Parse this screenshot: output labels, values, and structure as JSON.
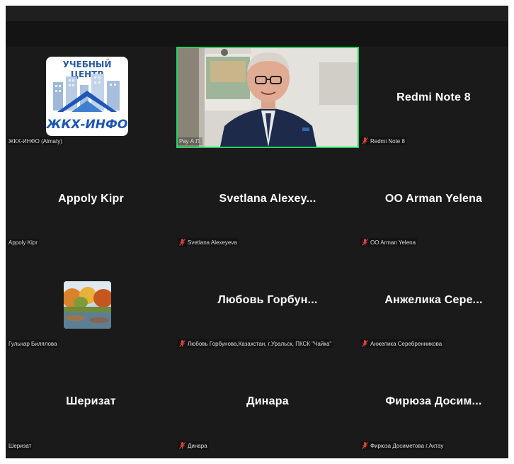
{
  "colors": {
    "background": "#1a1a1a",
    "active_speaker_border": "#23d160",
    "muted_icon": "#e0403a",
    "name_text": "#ffffff"
  },
  "logo": {
    "line1": "УЧЕБНЫЙ ЦЕНТР",
    "line2": "ЖКХ-ИНФО"
  },
  "participants": [
    {
      "display_name": "",
      "label": "ЖКХ-ИНФО (Almaty)",
      "muted": false,
      "video": "logo"
    },
    {
      "display_name": "",
      "label": "Рау А.П.",
      "muted": false,
      "video": "camera",
      "active_speaker": true
    },
    {
      "display_name": "Redmi Note 8",
      "label": "Redmi Note 8",
      "muted": true
    },
    {
      "display_name": "Appoly Kipr",
      "label": "Appoly Kipr",
      "muted": false
    },
    {
      "display_name": "Svetlana  Alexey...",
      "label": "Svetlana Alexeyeva",
      "muted": true
    },
    {
      "display_name": "OO Arman Yelena",
      "label": "OO Arman Yelena",
      "muted": true
    },
    {
      "display_name": "",
      "label": "Гульнар Билялова",
      "muted": false,
      "video": "autumn-photo"
    },
    {
      "display_name": "Любовь  Горбун...",
      "label": "Любовь Горбунова,Казахстан, г.Уральск, ПКСК \"Чайка\"",
      "muted": true
    },
    {
      "display_name": "Анжелика  Сере...",
      "label": "Анжелика Серебренникова",
      "muted": true
    },
    {
      "display_name": "Шеризат",
      "label": "Шеризат",
      "muted": false
    },
    {
      "display_name": "Динара",
      "label": "Динара",
      "muted": true
    },
    {
      "display_name": "Фирюза  Досим...",
      "label": "Фирюза Досиметова г.Актау",
      "muted": true
    }
  ]
}
